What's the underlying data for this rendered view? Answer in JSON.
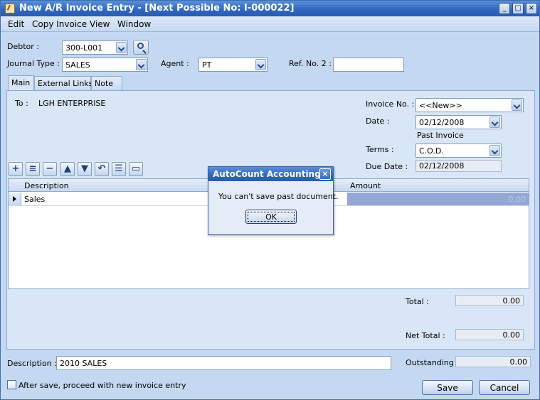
{
  "window": {
    "title": "New A/R Invoice Entry - [Next Possible No: I-000022]"
  },
  "menu": {
    "edit": "Edit",
    "copy_invoice": "Copy Invoice",
    "view": "View",
    "window": "Window"
  },
  "header": {
    "debtor_label": "Debtor :",
    "debtor_value": "300-L001",
    "journal_type_label": "Journal Type :",
    "journal_type_value": "SALES",
    "agent_label": "Agent :",
    "agent_value": "PT",
    "ref_no2_label": "Ref. No. 2 :",
    "ref_no2_value": ""
  },
  "tabs": [
    {
      "label": "Main"
    },
    {
      "label": "External Links"
    },
    {
      "label": "Note"
    }
  ],
  "main": {
    "to_label": "To :",
    "to_value": "LGH ENTERPRISE",
    "invoice_no_label": "Invoice No. :",
    "invoice_no_value": "<<New>>",
    "date_label": "Date :",
    "date_value": "02/12/2008",
    "past_invoice_note": "Past Invoice",
    "terms_label": "Terms :",
    "terms_value": "C.O.D.",
    "due_date_label": "Due Date :",
    "due_date_value": "02/12/2008"
  },
  "grid": {
    "columns": [
      "Description",
      "Amount"
    ],
    "rows": [
      {
        "description": "Sales",
        "amount": "0.00"
      }
    ]
  },
  "totals": {
    "total_label": "Total :",
    "total_value": "0.00",
    "net_total_label": "Net Total :",
    "net_total_value": "0.00",
    "outstanding_label": "Outstanding :",
    "outstanding_value": "0.00"
  },
  "footer": {
    "description_label": "Description :",
    "description_value": "2010 SALES",
    "proceed_checkbox_label": "After save, proceed with new invoice entry",
    "save_label": "Save",
    "cancel_label": "Cancel"
  },
  "dialog": {
    "title": "AutoCount Accounting",
    "message": "You can't save past document.",
    "ok_label": "OK"
  }
}
